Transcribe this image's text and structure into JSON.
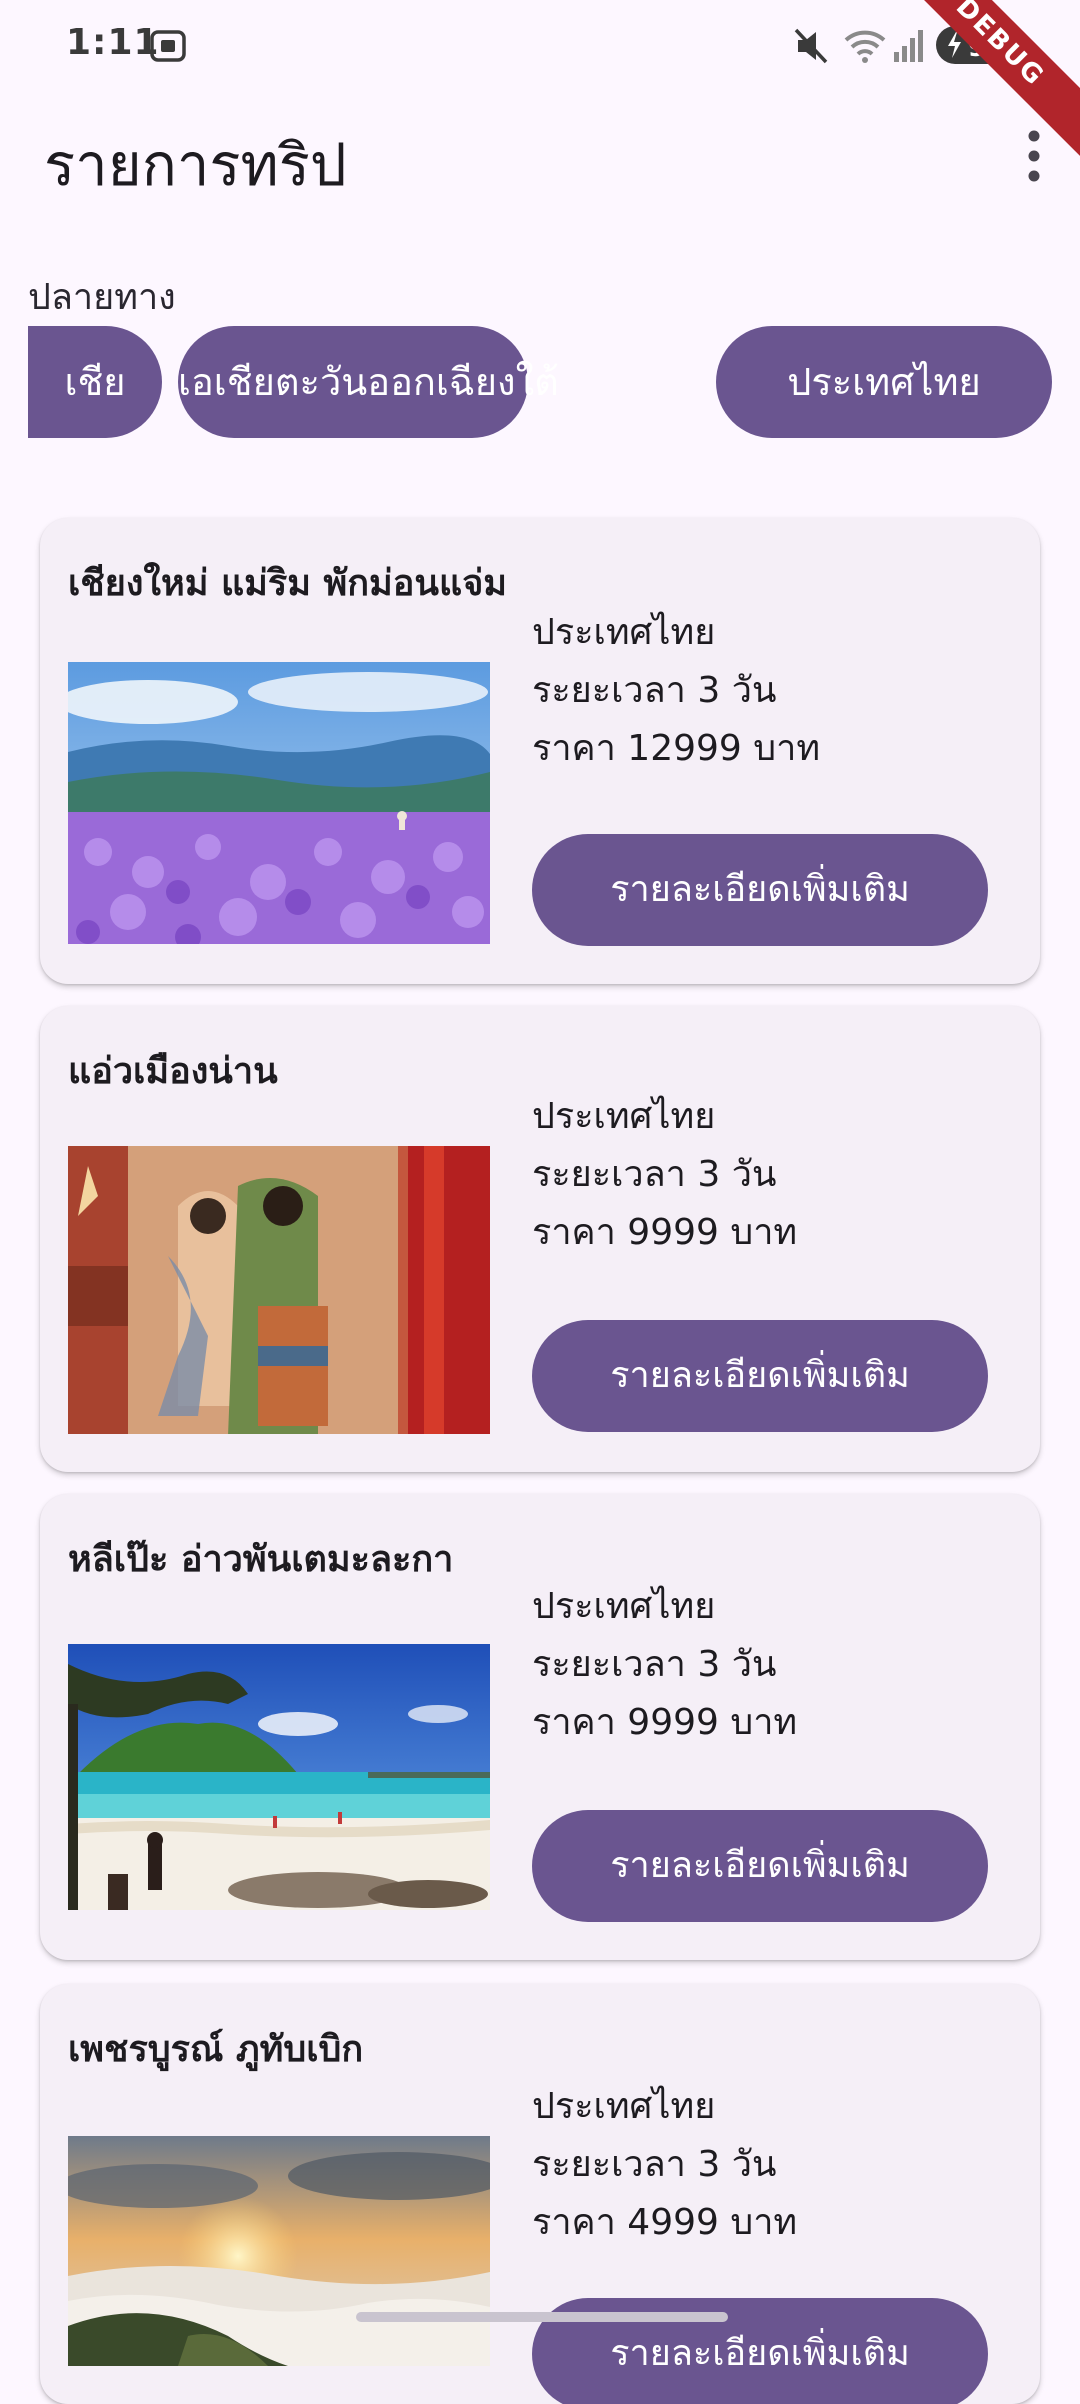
{
  "status_bar": {
    "time": "1:11",
    "battery": "91",
    "debug_label": "DEBUG"
  },
  "app_bar": {
    "title": "รายการทริป",
    "menu_icon": "more-vert-icon"
  },
  "filter": {
    "label": "ปลายทาง",
    "chips": [
      "เชีย",
      "เอเชียตะวันออกเฉียงใต้",
      "ประเทศไทย"
    ]
  },
  "trips": [
    {
      "title": "เชียงใหม่ แม่ริม พักม่อนแจ่ม",
      "country": "ประเทศไทย",
      "duration": "ระยะเวลา 3 วัน",
      "price": "ราคา 12999 บาท",
      "button": "รายละเอียดเพิ่มเติม",
      "image": "lavender-field-mountains"
    },
    {
      "title": "แอ่วเมืองน่าน",
      "country": "ประเทศไทย",
      "duration": "ระยะเวลา 3 วัน",
      "price": "ราคา 9999 บาท",
      "button": "รายละเอียดเพิ่มเติม",
      "image": "temple-mural-painting"
    },
    {
      "title": "หลีเป๊ะ อ่าวพันเตมะละกา",
      "country": "ประเทศไทย",
      "duration": "ระยะเวลา 3 วัน",
      "price": "ราคา 9999 บาท",
      "button": "รายละเอียดเพิ่มเติม",
      "image": "tropical-beach-island"
    },
    {
      "title": "เพชรบูรณ์ ภูทับเบิก",
      "country": "ประเทศไทย",
      "duration": "ระยะเวลา 3 วัน",
      "price": "ราคา 4999 บาท",
      "button": "รายละเอียดเพิ่มเติม",
      "image": "sunrise-sea-of-mist"
    }
  ],
  "colors": {
    "primary": "#6a5590",
    "background": "#fdf7ff",
    "card": "#f5eff7",
    "debug_banner": "#b1252b"
  }
}
